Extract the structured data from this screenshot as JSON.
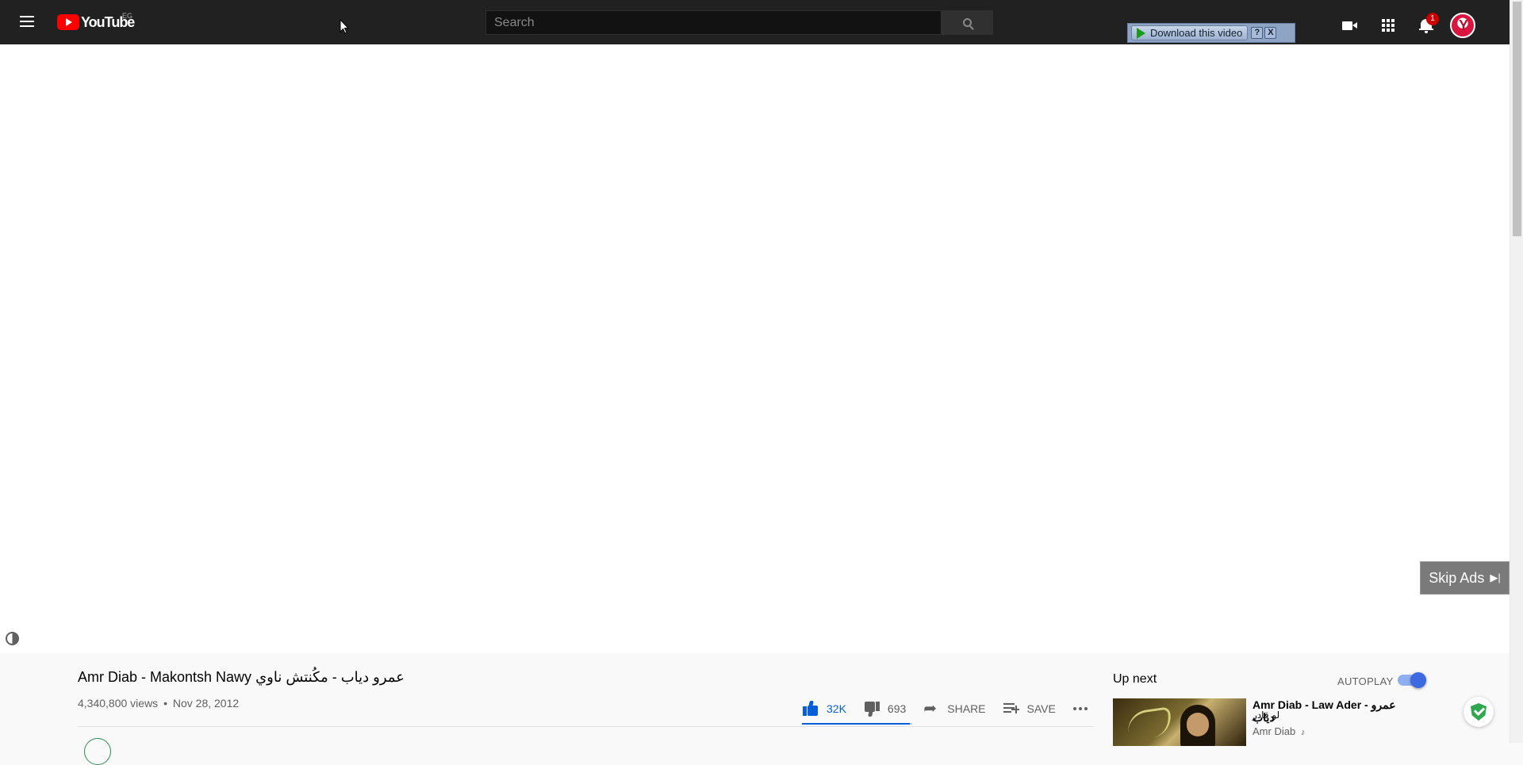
{
  "header": {
    "logo_text": "YouTube",
    "country_code": "EG",
    "notification_count": "1"
  },
  "search": {
    "placeholder": "Search"
  },
  "download_toolbar": {
    "label": "Download this video",
    "help": "?",
    "close": "X"
  },
  "player": {
    "skip_ads_label": "Skip Ads"
  },
  "video": {
    "title": "Amr Diab - Makontsh Nawy عمرو دياب - مكُنتش ناوي",
    "views": "4,340,800 views",
    "separator": "•",
    "date": "Nov 28, 2012",
    "likes": "32K",
    "dislikes": "693",
    "like_ratio": 0.979,
    "share_label": "SHARE",
    "save_label": "SAVE"
  },
  "sidebar": {
    "up_next_label": "Up next",
    "autoplay_label": "AUTOPLAY",
    "autoplay_on": true,
    "recommendations": [
      {
        "title": "Amr Diab - Law Ader - عمرو دياب",
        "title_cont": "لو قادر",
        "channel": "Amr Diab",
        "channel_badge": "♪"
      }
    ]
  },
  "colors": {
    "masthead": "#212121",
    "accent_blue": "#065fd4",
    "youtube_red": "#ff0000",
    "shield_green": "#2fa84f"
  }
}
